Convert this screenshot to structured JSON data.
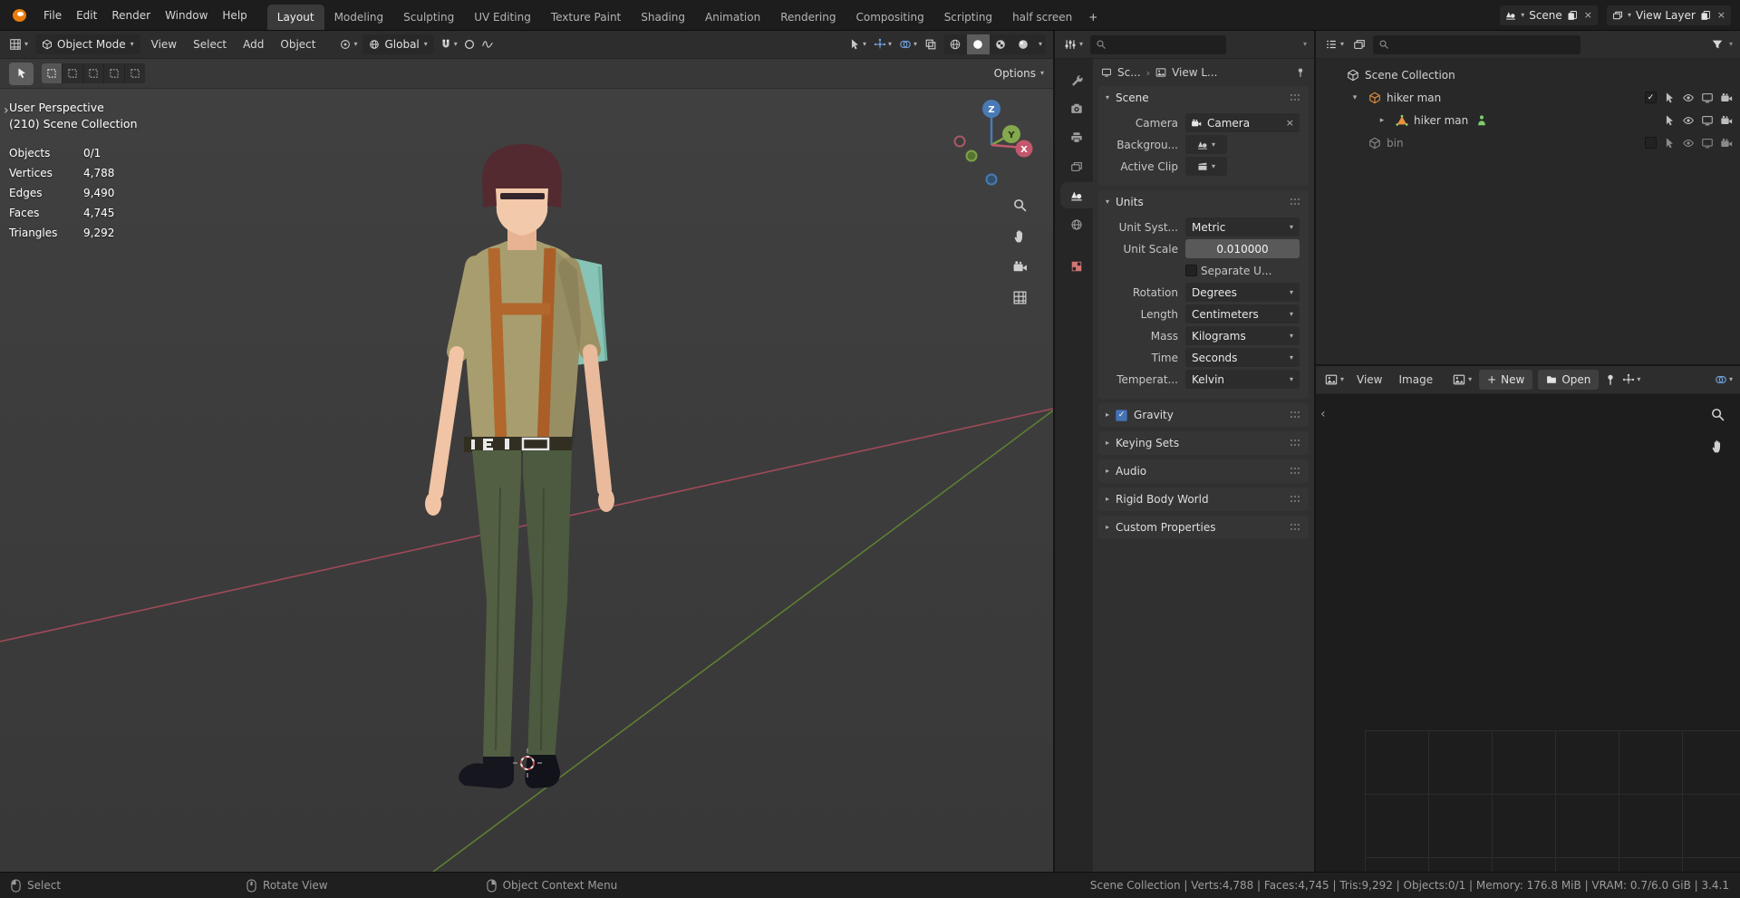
{
  "colors": {
    "accent": "#4772b3",
    "axis_x": "#a04a58",
    "axis_y": "#5e7e33",
    "axis_z": "#4a7ab5",
    "selected_object_orange": "#e8923e"
  },
  "icons": {
    "caret_down": "▾",
    "caret_right": "▸",
    "chevron_left": "‹",
    "chevron_right": "›",
    "check": "✓",
    "close": "×",
    "plus": "+"
  },
  "topbar": {
    "menus": [
      {
        "label": "File"
      },
      {
        "label": "Edit"
      },
      {
        "label": "Render"
      },
      {
        "label": "Window"
      },
      {
        "label": "Help"
      }
    ],
    "tabs": [
      {
        "label": "Layout"
      },
      {
        "label": "Modeling"
      },
      {
        "label": "Sculpting"
      },
      {
        "label": "UV Editing"
      },
      {
        "label": "Texture Paint"
      },
      {
        "label": "Shading"
      },
      {
        "label": "Animation"
      },
      {
        "label": "Rendering"
      },
      {
        "label": "Compositing"
      },
      {
        "label": "Scripting"
      },
      {
        "label": "half screen"
      },
      {
        "label": "+"
      }
    ],
    "scene": {
      "label": "Scene"
    },
    "view_layer": {
      "label": "View Layer"
    }
  },
  "viewport": {
    "header": {
      "mode": "Object Mode",
      "menus": [
        {
          "label": "View"
        },
        {
          "label": "Select"
        },
        {
          "label": "Add"
        },
        {
          "label": "Object"
        }
      ],
      "orientation": "Global"
    },
    "tool_header": {
      "options_label": "Options"
    },
    "overlay": {
      "view_label": "User Perspective",
      "collection_label": "(210) Scene Collection",
      "stats": [
        {
          "label": "Objects",
          "value": "0/1"
        },
        {
          "label": "Vertices",
          "value": "4,788"
        },
        {
          "label": "Edges",
          "value": "9,490"
        },
        {
          "label": "Faces",
          "value": "4,745"
        },
        {
          "label": "Triangles",
          "value": "9,292"
        }
      ]
    },
    "gizmo": {
      "x": "X",
      "y": "Y",
      "z": "Z"
    }
  },
  "properties": {
    "breadcrumb": {
      "scene": "Sc...",
      "view_layer": "View L..."
    },
    "scene_panel": {
      "title": "Scene",
      "camera": {
        "label": "Camera",
        "value": "Camera"
      },
      "background": {
        "label": "Backgrou..."
      },
      "active_clip": {
        "label": "Active Clip"
      }
    },
    "units_panel": {
      "title": "Units",
      "unit_system": {
        "label": "Unit Syst...",
        "value": "Metric"
      },
      "unit_scale": {
        "label": "Unit Scale",
        "value": "0.010000"
      },
      "separate_units": {
        "label": "Separate U..."
      },
      "rotation": {
        "label": "Rotation",
        "value": "Degrees"
      },
      "length": {
        "label": "Length",
        "value": "Centimeters"
      },
      "mass": {
        "label": "Mass",
        "value": "Kilograms"
      },
      "time": {
        "label": "Time",
        "value": "Seconds"
      },
      "temperature": {
        "label": "Temperat...",
        "value": "Kelvin"
      }
    },
    "collapsed_panels": [
      {
        "title": "Gravity"
      },
      {
        "title": "Keying Sets"
      },
      {
        "title": "Audio"
      },
      {
        "title": "Rigid Body World"
      },
      {
        "title": "Custom Properties"
      }
    ]
  },
  "outliner": {
    "rows": [
      {
        "label": "Scene Collection"
      },
      {
        "label": "hiker man"
      },
      {
        "label": "hiker man"
      },
      {
        "label": "bin"
      }
    ]
  },
  "image_editor": {
    "menus": [
      {
        "label": "View"
      },
      {
        "label": "Image"
      }
    ],
    "new_button": "New",
    "open_button": "Open"
  },
  "statusbar": {
    "hints": [
      {
        "label": "Select"
      },
      {
        "label": "Rotate View"
      },
      {
        "label": "Object Context Menu"
      }
    ],
    "info": "Scene Collection | Verts:4,788 | Faces:4,745 | Tris:9,292 | Objects:0/1 | Memory: 176.8 MiB | VRAM: 0.7/6.0 GiB | 3.4.1"
  }
}
